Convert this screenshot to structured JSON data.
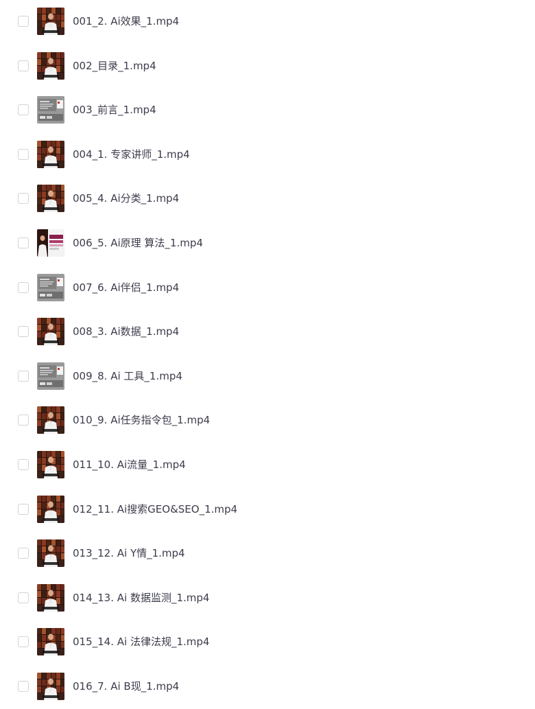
{
  "files": [
    {
      "name": "001_2. Ai效果_1.mp4",
      "thumbnail": "video-presenter-thumbnail"
    },
    {
      "name": "002_目录_1.mp4",
      "thumbnail": "video-presenter-thumbnail"
    },
    {
      "name": "003_前言_1.mp4",
      "thumbnail": "video-slides-thumbnail"
    },
    {
      "name": "004_1. 专家讲师_1.mp4",
      "thumbnail": "video-presenter-thumbnail"
    },
    {
      "name": "005_4. Ai分类_1.mp4",
      "thumbnail": "video-presenter-thumbnail"
    },
    {
      "name": "006_5. Ai原理 算法_1.mp4",
      "thumbnail": "video-split-thumbnail"
    },
    {
      "name": "007_6. Ai伴侣_1.mp4",
      "thumbnail": "video-slides-thumbnail"
    },
    {
      "name": "008_3. Ai数据_1.mp4",
      "thumbnail": "video-presenter-thumbnail"
    },
    {
      "name": "009_8. Ai 工具_1.mp4",
      "thumbnail": "video-slides-thumbnail"
    },
    {
      "name": "010_9. Ai任务指令包_1.mp4",
      "thumbnail": "video-presenter-thumbnail"
    },
    {
      "name": "011_10. Ai流量_1.mp4",
      "thumbnail": "video-presenter-thumbnail"
    },
    {
      "name": "012_11. Ai搜索GEO&SEO_1.mp4",
      "thumbnail": "video-presenter-thumbnail"
    },
    {
      "name": "013_12. Ai Y情_1.mp4",
      "thumbnail": "video-presenter-thumbnail"
    },
    {
      "name": "014_13. Ai 数据监测_1.mp4",
      "thumbnail": "video-presenter-thumbnail"
    },
    {
      "name": "015_14. Ai 法律法规_1.mp4",
      "thumbnail": "video-presenter-thumbnail"
    },
    {
      "name": "016_7. Ai B现_1.mp4",
      "thumbnail": "video-presenter-thumbnail"
    }
  ],
  "colors": {
    "text": "#3c3c4c",
    "checkbox_border": "#d3d3d8",
    "background": "#ffffff"
  }
}
